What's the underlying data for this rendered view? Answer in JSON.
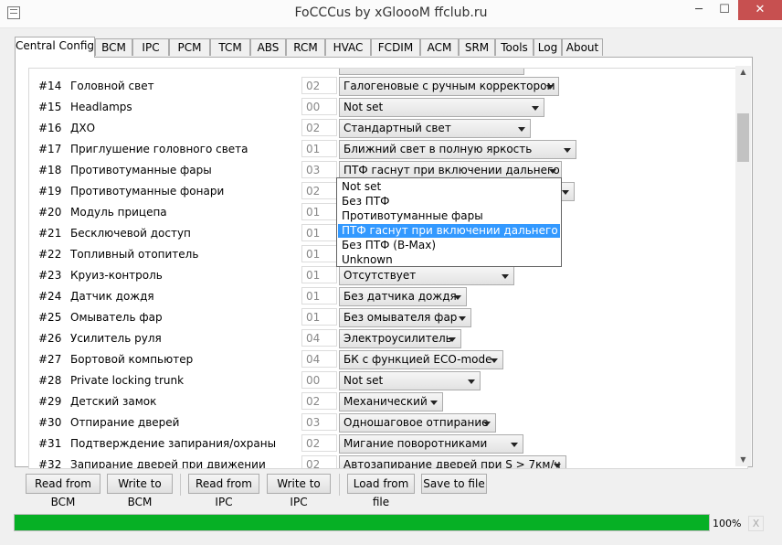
{
  "window": {
    "title": "FoCCCus by xGloooM ffclub.ru",
    "icon": "app-window-icon",
    "controls": {
      "minimize": "─",
      "maximize": "☐",
      "close": "✕"
    }
  },
  "tabs": [
    "Central Config",
    "BCM",
    "IPC",
    "PCM",
    "TCM",
    "ABS",
    "RCM",
    "HVAC",
    "FCDIM",
    "ACM",
    "SRM",
    "Tools",
    "Log",
    "About"
  ],
  "rows": [
    {
      "num": "#14",
      "name": "Головной свет",
      "code": "02",
      "value": "Галогеновые с ручным корректором"
    },
    {
      "num": "#15",
      "name": "Headlamps",
      "code": "00",
      "value": "Not set"
    },
    {
      "num": "#16",
      "name": "ДХО",
      "code": "02",
      "value": "Стандартный свет"
    },
    {
      "num": "#17",
      "name": "Приглушение головного света",
      "code": "01",
      "value": "Ближний свет в полную яркость"
    },
    {
      "num": "#18",
      "name": "Противотуманные фары",
      "code": "03",
      "value": "ПТФ гаснут при включении дальнего"
    },
    {
      "num": "#19",
      "name": "Противотуманные фонари",
      "code": "02",
      "value": ""
    },
    {
      "num": "#20",
      "name": "Модуль прицепа",
      "code": "01",
      "value": ""
    },
    {
      "num": "#21",
      "name": "Бесключевой доступ",
      "code": "01",
      "value": ""
    },
    {
      "num": "#22",
      "name": "Топливный отопитель",
      "code": "01",
      "value": ""
    },
    {
      "num": "#23",
      "name": "Круиз-контроль",
      "code": "01",
      "value": "Отсутствует"
    },
    {
      "num": "#24",
      "name": "Датчик дождя",
      "code": "01",
      "value": "Без датчика дождя"
    },
    {
      "num": "#25",
      "name": "Омыватель фар",
      "code": "01",
      "value": "Без омывателя фар"
    },
    {
      "num": "#26",
      "name": "Усилитель руля",
      "code": "04",
      "value": "Электроусилитель"
    },
    {
      "num": "#27",
      "name": "Бортовой компьютер",
      "code": "04",
      "value": "БК с функцией ECO-mode"
    },
    {
      "num": "#28",
      "name": "Private locking trunk",
      "code": "00",
      "value": "Not set"
    },
    {
      "num": "#29",
      "name": "Детский замок",
      "code": "02",
      "value": "Механический"
    },
    {
      "num": "#30",
      "name": "Отпирание дверей",
      "code": "03",
      "value": "Одношаговое отпирание"
    },
    {
      "num": "#31",
      "name": "Подтверждение запирания/охраны",
      "code": "02",
      "value": "Мигание поворотниками"
    },
    {
      "num": "#32",
      "name": "Запирание дверей при движении",
      "code": "02",
      "value": "Автозапирание дверей при S > 7км/ч"
    }
  ],
  "dropdown": {
    "options": [
      "Not set",
      "Без ПТФ",
      "Противотуманные фары",
      "ПТФ гаснут при включении дальнего",
      "Без ПТФ (B-Max)",
      "Unknown"
    ],
    "selected_index": 3
  },
  "buttons": {
    "read_bcm": "Read from BCM",
    "write_bcm": "Write to BCM",
    "read_ipc": "Read from IPC",
    "write_ipc": "Write to IPC",
    "load_file": "Load from file",
    "save_file": "Save to file"
  },
  "progress": {
    "value": 1.0,
    "label": "100%",
    "cancel": "X",
    "fill_color": "#06b025"
  },
  "scrollbar": {
    "up": "▲",
    "down": "▼"
  },
  "colors": {
    "selection": "#3399ff",
    "close_button": "#c75050"
  }
}
